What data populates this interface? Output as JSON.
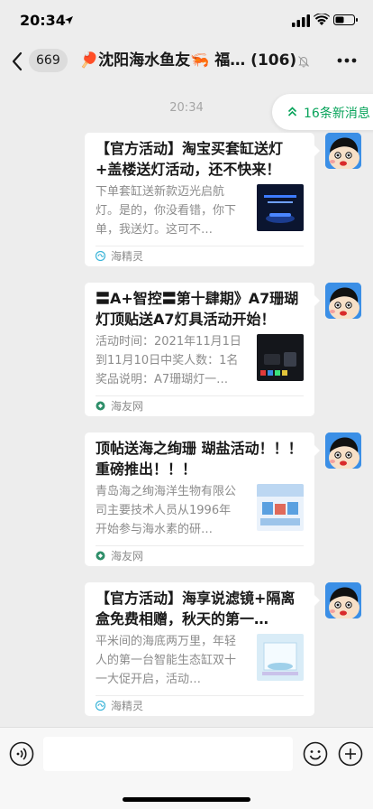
{
  "status_bar": {
    "time": "20:34"
  },
  "nav": {
    "unread_count": "669",
    "title": "🏓沈阳海水鱼友🦐 福… (106)"
  },
  "chat": {
    "timestamp": "20:34",
    "new_messages": "16条新消息",
    "cards": [
      {
        "title": "【官方活动】淘宝买套缸送灯+盖楼送灯活动，还不快来！",
        "desc": "下单套缸送新款迈光启航灯。是的，你没看错，你下单，我送灯。这可不…",
        "source": "海精灵"
      },
      {
        "title": "〓A+智控〓第十肆期》A7珊瑚灯顶贴送A7灯具活动开始！",
        "desc": "活动时间：2021年11月1日到11月10日中奖人数：1名奖品说明：A7珊瑚灯一…",
        "source": "海友网"
      },
      {
        "title": "顶帖送海之绚珊 瑚盐活动！！！ 重磅推出！！！",
        "desc": "青岛海之绚海洋生物有限公司主要技术人员从1996年开始参与海水素的研…",
        "source": "海友网"
      },
      {
        "title": "【官方活动】海享说滤镜+隔离盒免费相赠，秋天的第一…",
        "desc": "平米间的海底两万里，年轻人的第一台智能生态缸双十一大促开启，活动…",
        "source": "海精灵"
      }
    ]
  },
  "input": {
    "placeholder": ""
  },
  "colors": {
    "accent": "#07a35a",
    "background": "#ededed"
  }
}
